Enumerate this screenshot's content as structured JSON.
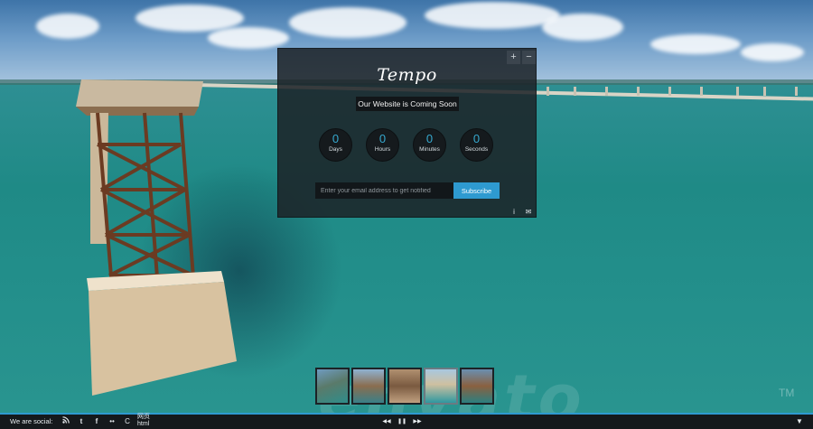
{
  "brand": {
    "logo_text": "Tempo",
    "tagline": "Our Website is Coming Soon"
  },
  "panel_controls": {
    "expand": "+",
    "collapse": "−"
  },
  "countdown": [
    {
      "value": "0",
      "label": "Days"
    },
    {
      "value": "0",
      "label": "Hours"
    },
    {
      "value": "0",
      "label": "Minutes"
    },
    {
      "value": "0",
      "label": "Seconds"
    }
  ],
  "subscribe": {
    "placeholder": "Enter your email address to get notified",
    "button_label": "Subscribe"
  },
  "panel_footer": {
    "info": "i",
    "mail": "✉"
  },
  "bottom_bar": {
    "social_label": "We are social:",
    "icons": [
      "rss-icon",
      "twitter-icon",
      "facebook-icon",
      "flickr-icon",
      "dribbble-icon",
      "google-plus-icon"
    ],
    "page_label_1": "网页",
    "page_label_2": "html",
    "player": {
      "prev": "◀◀",
      "pause": "❚❚",
      "next": "▶▶"
    },
    "toggle": "▼"
  },
  "thumbnails": [
    "thumb-1",
    "thumb-2",
    "thumb-3",
    "thumb-4",
    "thumb-5"
  ],
  "colors": {
    "accent": "#2e9ad0",
    "counter_number": "#36a9cf",
    "panel": "#1c2226"
  }
}
